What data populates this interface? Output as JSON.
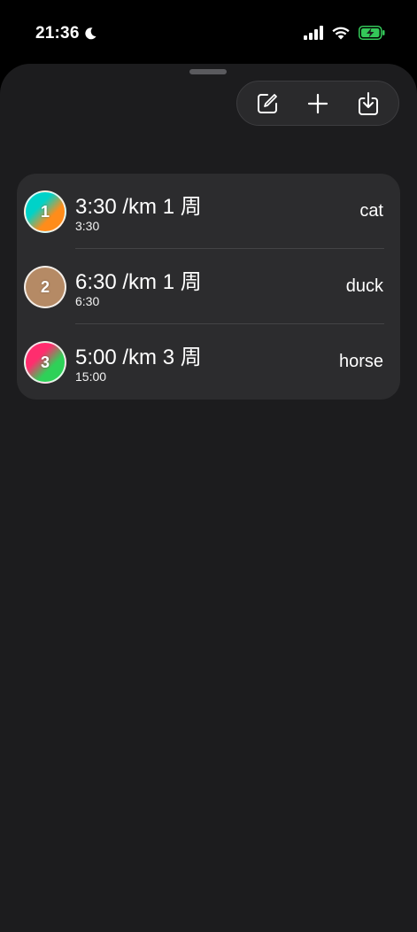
{
  "status_bar": {
    "time": "21:36",
    "icons": [
      "moon-icon",
      "cellular-signal-icon",
      "wifi-icon",
      "battery-charging-icon"
    ]
  },
  "toolbar": {
    "buttons": [
      {
        "icon": "compose-icon"
      },
      {
        "icon": "plus-icon"
      },
      {
        "icon": "import-icon"
      }
    ]
  },
  "list": {
    "items": [
      {
        "badge": "1",
        "pace": "3:30 /km",
        "laps": "1 周",
        "total_time": "3:30",
        "name": "cat",
        "gradient": [
          "#00d2c8",
          "#ff8c1a"
        ]
      },
      {
        "badge": "2",
        "pace": "6:30 /km",
        "laps": "1 周",
        "total_time": "6:30",
        "name": "duck",
        "gradient": [
          "#b58a65",
          "#b58a65"
        ]
      },
      {
        "badge": "3",
        "pace": "5:00 /km",
        "laps": "3 周",
        "total_time": "15:00",
        "name": "horse",
        "gradient": [
          "#ff2d6e",
          "#2ed158"
        ]
      }
    ]
  },
  "colors": {
    "background": "#000000",
    "sheet": "#1c1c1e",
    "card": "#2c2c2e",
    "battery": "#34c759"
  }
}
